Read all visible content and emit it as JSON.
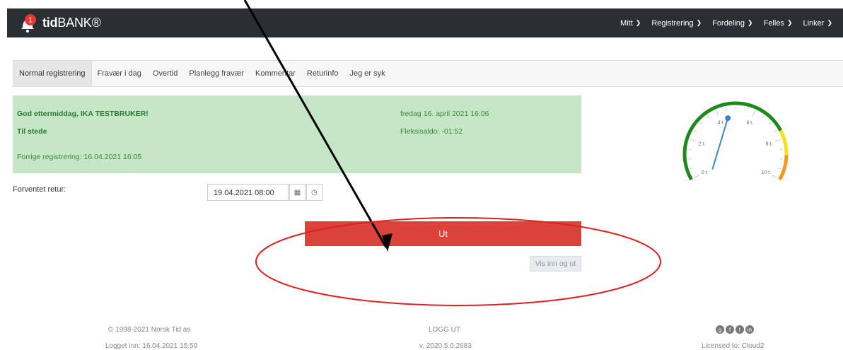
{
  "header": {
    "notification_count": "1",
    "logo_prefix": "tid",
    "logo_suffix": "BANK®",
    "nav": [
      "Mitt",
      "Registrering",
      "Fordeling",
      "Felles",
      "Linker"
    ]
  },
  "tabs": [
    "Normal registrering",
    "Fravær i dag",
    "Overtid",
    "Planlegg fravær",
    "Kommentar",
    "Returinfo",
    "Jeg er syk"
  ],
  "status": {
    "greeting": "God ettermiddag, IKA TESTBRUKER!",
    "presence": "Til stede",
    "last_registration": "Forrige registrering: 16.04.2021 16:05",
    "datetime": "fredag 16. april 2021 16:06",
    "flex_balance": "Fleksisaldo: -01:52"
  },
  "return": {
    "label": "Forventet retur:",
    "value": "19.04.2021 08:00"
  },
  "actions": {
    "out_label": "Ut",
    "show_label": "Vis inn og ut"
  },
  "gauge": {
    "ticks": [
      "0 t.",
      "2 t.",
      "4 t.",
      "6 t.",
      "8 t.",
      "10 t."
    ],
    "value_hours": 4.5,
    "max_hours": 10
  },
  "footer": {
    "copyright": "© 1998-2021 Norsk Tid as",
    "logged_in": "Logget inn: 16.04.2021 15:59",
    "logout": "LOGG UT",
    "version": "v. 2020.5.0.2683",
    "licensed": "Licensed to: Cloud2"
  }
}
